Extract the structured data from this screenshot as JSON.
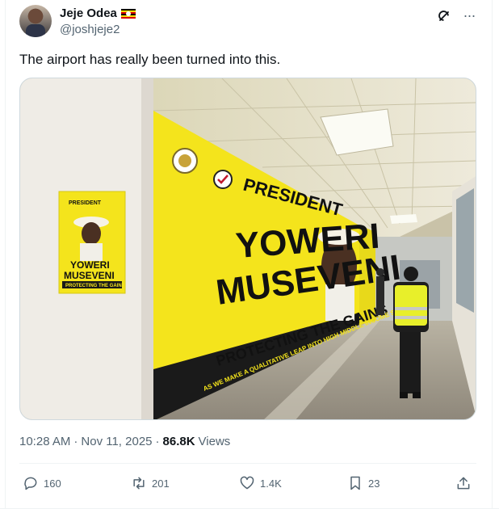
{
  "author": {
    "name": "Jeje Odea",
    "handle": "@joshjeje2",
    "flag_icon": "uganda-flag-icon"
  },
  "post": {
    "text": "The airport has really been turned into this.",
    "time": "10:28 AM",
    "date": "Nov 11, 2025",
    "views_count": "86.8K",
    "views_label": "Views"
  },
  "image": {
    "poster_header": "PRESIDENT",
    "poster_name_line1": "YOWERI",
    "poster_name_line2": "MUSEVENI",
    "poster_slogan": "PROTECTING THE GAINS",
    "billboard_header": "PRESIDENT",
    "billboard_name_line1": "YOWERI",
    "billboard_name_line2": "MUSEVENI",
    "billboard_slogan": "PROTECTING THE GAINS",
    "billboard_tagline": "AS WE MAKE A QUALITATIVE LEAP INTO HIGH MIDDLE INCOME STATUS"
  },
  "actions": {
    "replies": "160",
    "reposts": "201",
    "likes": "1.4K",
    "bookmarks": "23"
  },
  "colors": {
    "text_primary": "#0f1419",
    "text_secondary": "#536471",
    "border": "#eff3f4",
    "billboard_yellow": "#f4e41c"
  }
}
